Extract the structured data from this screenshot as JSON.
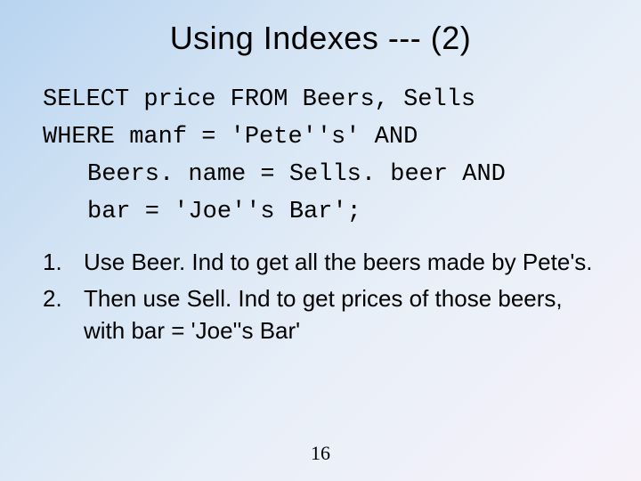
{
  "title": "Using Indexes --- (2)",
  "code": {
    "l1": "SELECT price FROM Beers, Sells",
    "l2": "WHERE manf = 'Pete''s' AND",
    "l3": "Beers. name = Sells. beer AND",
    "l4": "bar = 'Joe''s Bar';"
  },
  "list": {
    "n1": "1.",
    "t1": "Use Beer. Ind to get all the beers made by Pete's.",
    "n2": "2.",
    "t2": "Then use Sell. Ind to get prices of those beers, with bar = 'Joe''s Bar'"
  },
  "page_number": "16"
}
